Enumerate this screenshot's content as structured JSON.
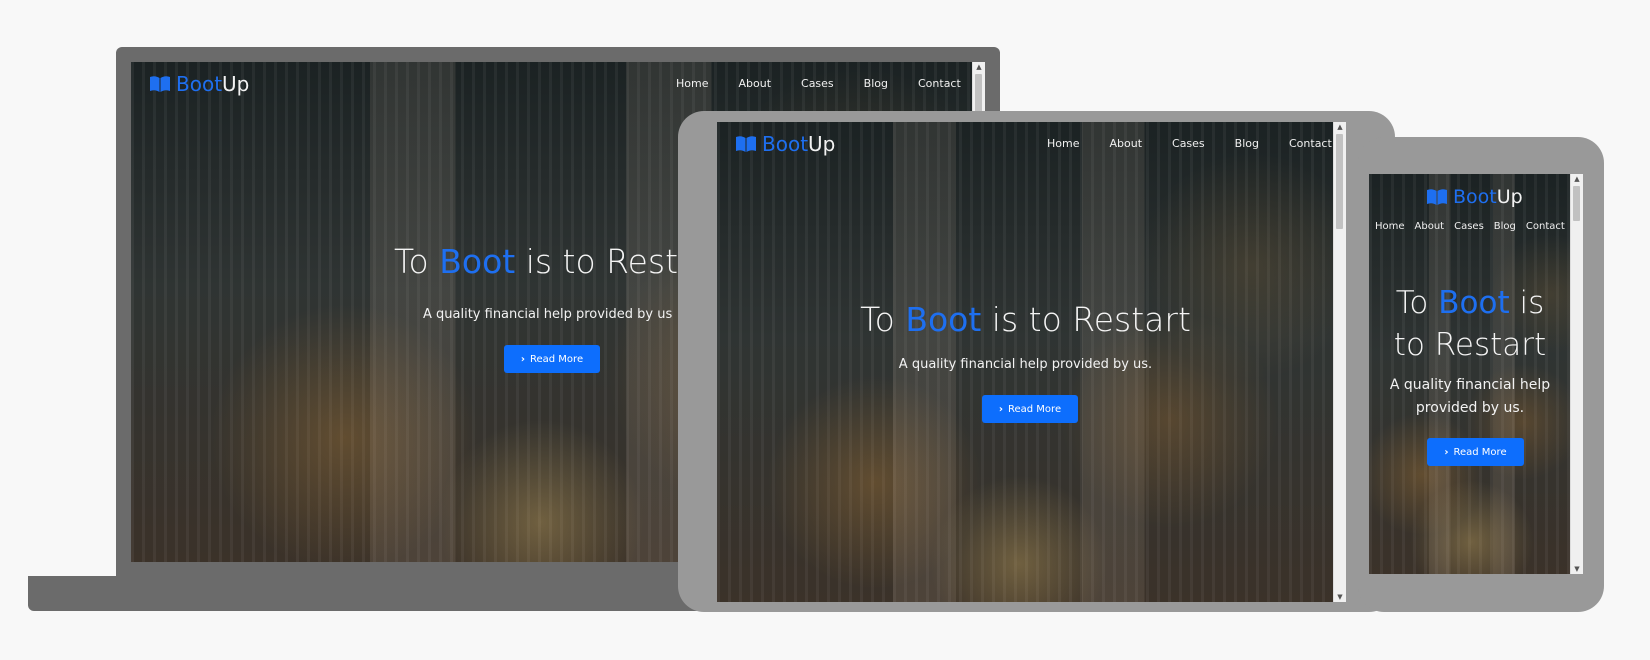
{
  "brand": {
    "boot": "Boot",
    "up": "Up",
    "icon": "book-icon"
  },
  "nav": {
    "items": [
      {
        "label": "Home"
      },
      {
        "label": "About"
      },
      {
        "label": "Cases"
      },
      {
        "label": "Blog"
      },
      {
        "label": "Contact"
      }
    ]
  },
  "hero": {
    "title_prefix": "To ",
    "title_accent": "Boot",
    "title_suffix": " is to Restart",
    "laptop_title_suffix_visible": " is to Resta",
    "laptop_subtitle_visible": "A quality financial help provided by us",
    "subtitle": "A quality financial help provided by us.",
    "phone_title_line1_suffix": " is",
    "phone_title_line2": "to Restart",
    "phone_subtitle_line1": "A quality financial help",
    "phone_subtitle_line2": "provided by us.",
    "button_label": "Read More",
    "button_icon": "chevron-right-icon"
  },
  "colors": {
    "accent": "#1e6ff0",
    "button": "#0d6efd",
    "frame_dark": "#6b6b6b",
    "frame_light": "#999999",
    "page_bg": "#f8f8f8"
  }
}
